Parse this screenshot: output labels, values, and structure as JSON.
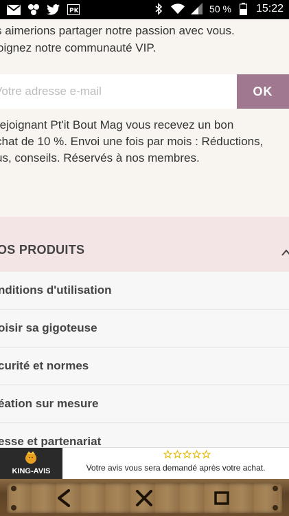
{
  "status_bar": {
    "battery_percent": "50 %",
    "time": "15:22",
    "left_icons": [
      "gmail-icon",
      "apps-icon",
      "twitter-icon",
      "pk-icon"
    ],
    "right_icons": [
      "bluetooth-icon",
      "wifi-icon",
      "signal-icon",
      "battery-icon"
    ]
  },
  "newsletter": {
    "intro_line1": "s aimerions partager notre passion avec vous.",
    "intro_line2": "oignez notre communauté VIP.",
    "email_placeholder": "Votre adresse e-mail",
    "ok_label": "OK",
    "desc_line1": "rejoignant Pt'it Bout Mag vous recevez un bon",
    "desc_line2": "chat de 10 %. Envoi une fois par mois : Réductions,",
    "desc_line3": "us, conseils. Réservés à nos membres."
  },
  "products_section": {
    "title": "OS PRODUITS",
    "links": [
      "nditions d'utilisation",
      "oisir sa gigoteuse",
      "curité et normes",
      "éation sur mesure",
      "esse et partenariat"
    ]
  },
  "king_avis": {
    "brand": "KING-AVIS",
    "message": "Votre avis vous sera demandé après votre achat.",
    "star_count": 5
  },
  "colors": {
    "ok_button": "#a0788f",
    "products_header_bg": "#f3e5e6",
    "page_bg": "#f8f4ef",
    "star_color": "#e0b800"
  }
}
